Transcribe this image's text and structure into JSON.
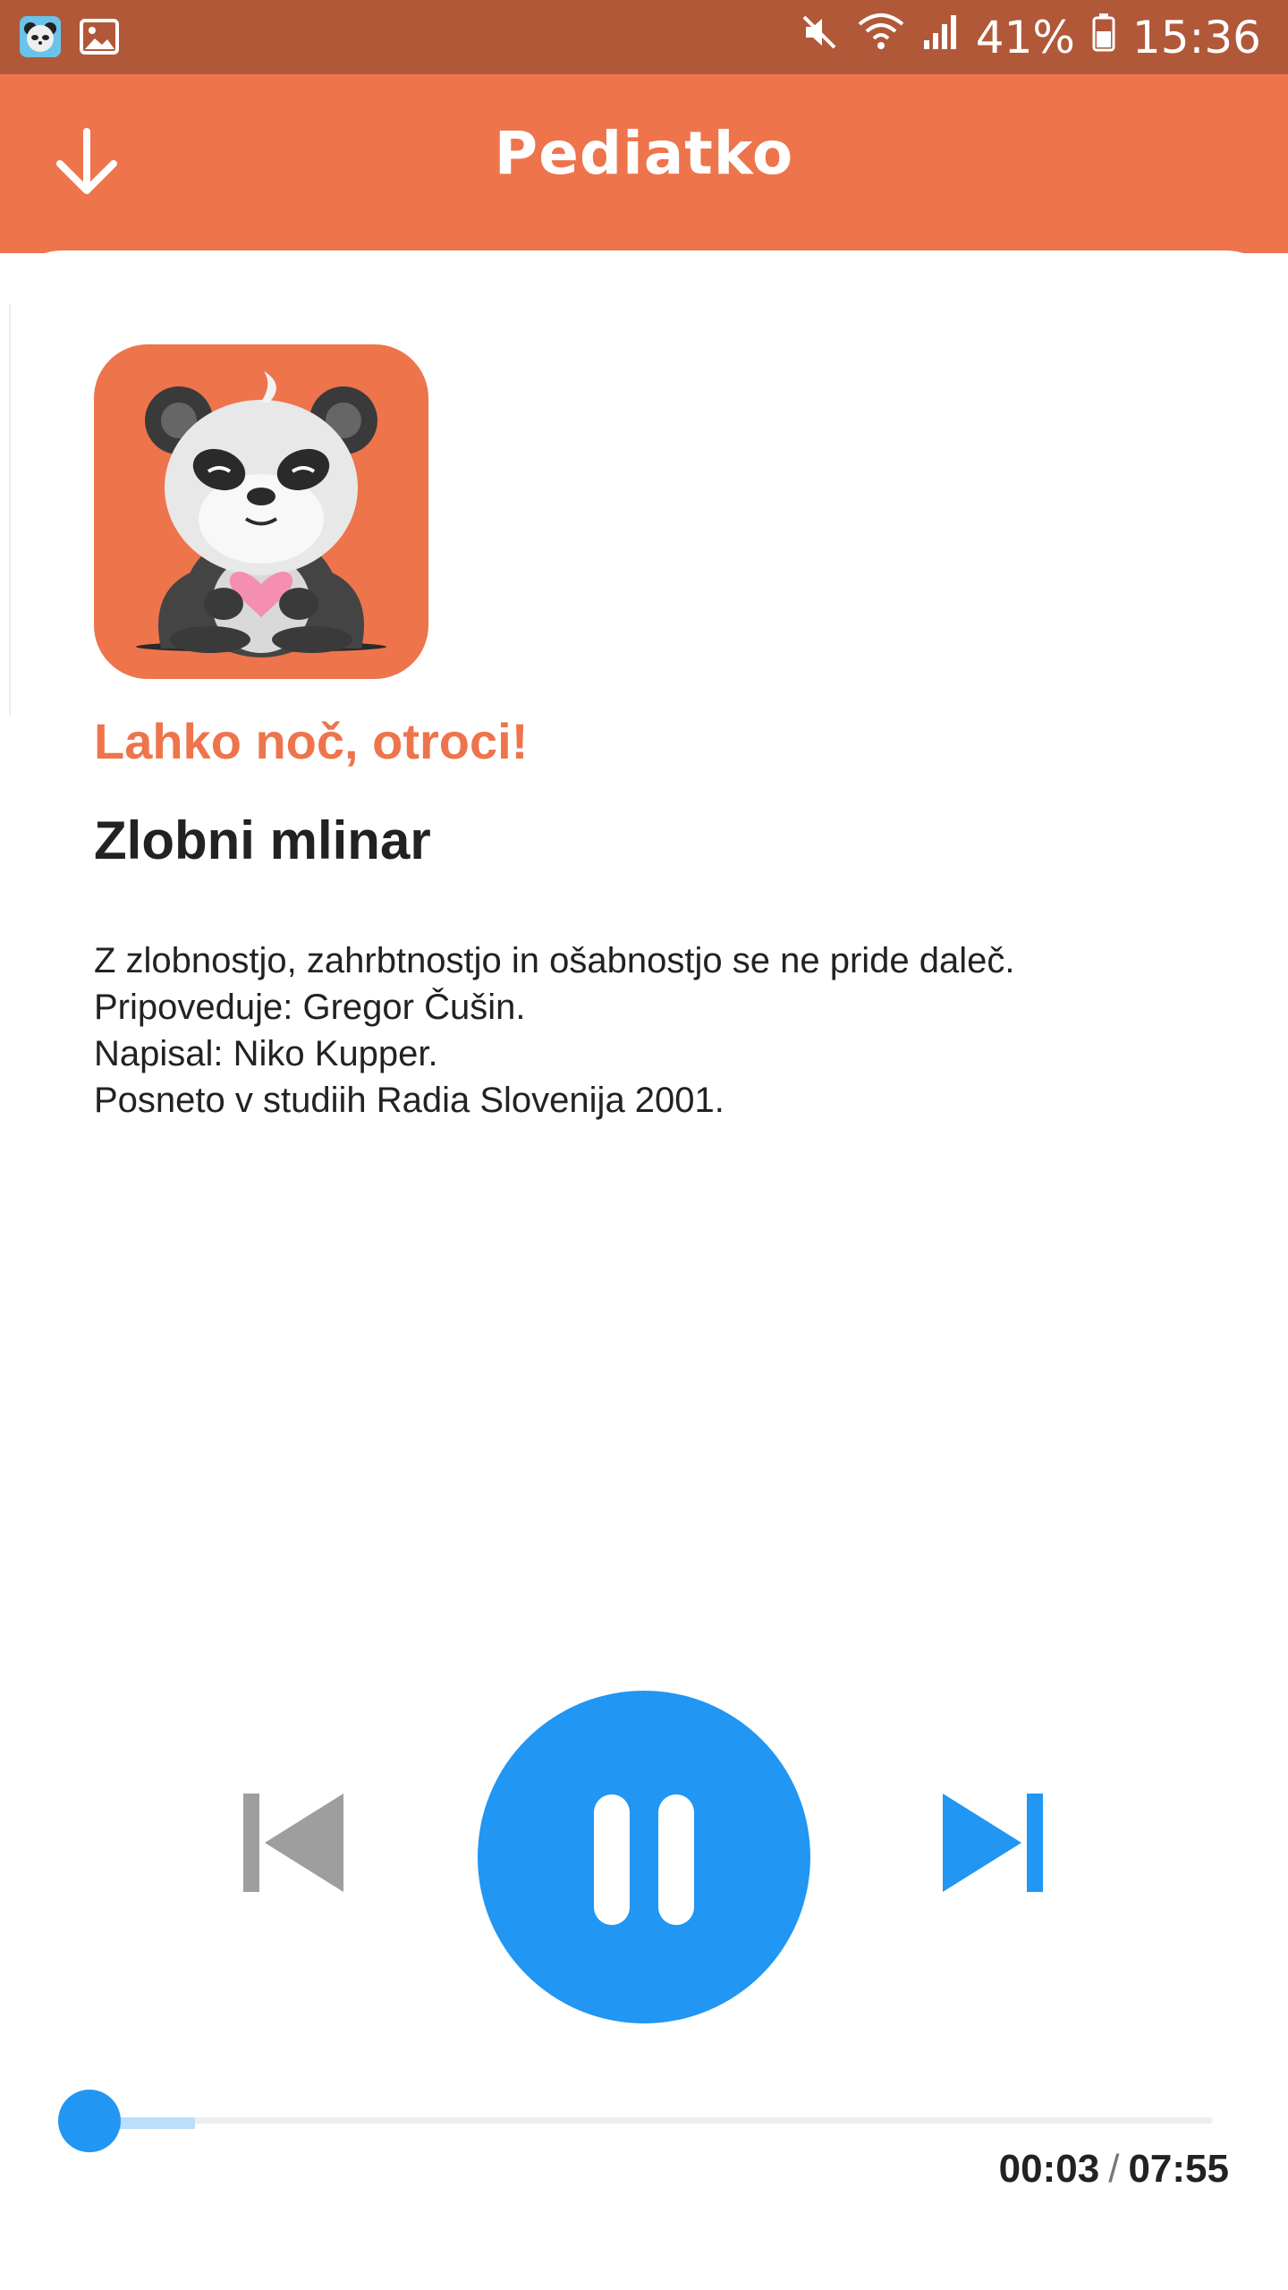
{
  "status_bar": {
    "battery": "41%",
    "time": "15:36",
    "icons": [
      "panda-app-icon",
      "gallery-icon",
      "mute-icon",
      "wifi-icon",
      "signal-icon",
      "battery-icon"
    ]
  },
  "app_bar": {
    "brand": "Pediatko",
    "download_icon": "arrow-down-icon"
  },
  "episode": {
    "show_title": "Lahko noč, otroci!",
    "title": "Zlobni mlinar",
    "description": [
      "Z zlobnostjo, zahrbtnostjo in ošabnostjo se ne pride daleč.",
      "Pripoveduje: Gregor Čušin.",
      "Napisal: Niko Kupper.",
      "Posneto v studiih Radia Slovenija 2001."
    ]
  },
  "player": {
    "current_time": "00:03",
    "separator": "/",
    "duration": "07:55",
    "progress_fraction": 0.006,
    "buffered_fraction": 0.1,
    "state": "playing"
  },
  "colors": {
    "brand_orange": "#ee744c",
    "status_bar": "#b15839",
    "accent_blue": "#2196f3",
    "buffer_blue": "#bbdefb",
    "disabled_gray": "#9e9e9e"
  }
}
